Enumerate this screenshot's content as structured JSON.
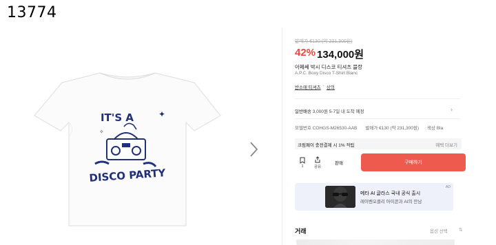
{
  "page_id": "13774",
  "price": {
    "original": "발매가 €130 (약 231,300원)",
    "discount": "42%",
    "current": "134,000원"
  },
  "product": {
    "title_ko": "아페쎄 박시 디스코 티셔츠 블랑",
    "title_en": "A.P.C. Boxy Disco T-Shirt Blanc",
    "breadcrumb": [
      "반소매 티셔츠",
      "상의"
    ],
    "breadcrumb_sep": "·",
    "graphic_text_top": "IT'S A",
    "graphic_text_bottom": "DISCO PARTY"
  },
  "shipping": {
    "label": "일반배송",
    "fee": "3,000원",
    "eta": "5-7일 내 도착 예정"
  },
  "model": {
    "label": "모델번호",
    "value": "COHGS-M26530-AAB",
    "release_label": "발매가",
    "release_value": "€130 (약 231,300원)",
    "color_label": "색상",
    "color_value": "Bla"
  },
  "points": {
    "text": "크림페이 충전결제 시 1% 적립",
    "more": "혜택 더보기"
  },
  "actions": {
    "save_count": "1",
    "share_label": "공유",
    "sell_label": "판매",
    "buy_label": "구매하기"
  },
  "ad": {
    "badge": "AD",
    "title": "메타 AI 글라스 국내 공식 출시",
    "subtitle": "레이벤오클리 아이콘과 AI의 만남"
  },
  "trade": {
    "title": "거래",
    "option": "옵션 선택"
  },
  "colors": {
    "accent": "#f0453c",
    "buy_button": "#ef5a4f",
    "graphic_navy": "#1f2f7a"
  }
}
